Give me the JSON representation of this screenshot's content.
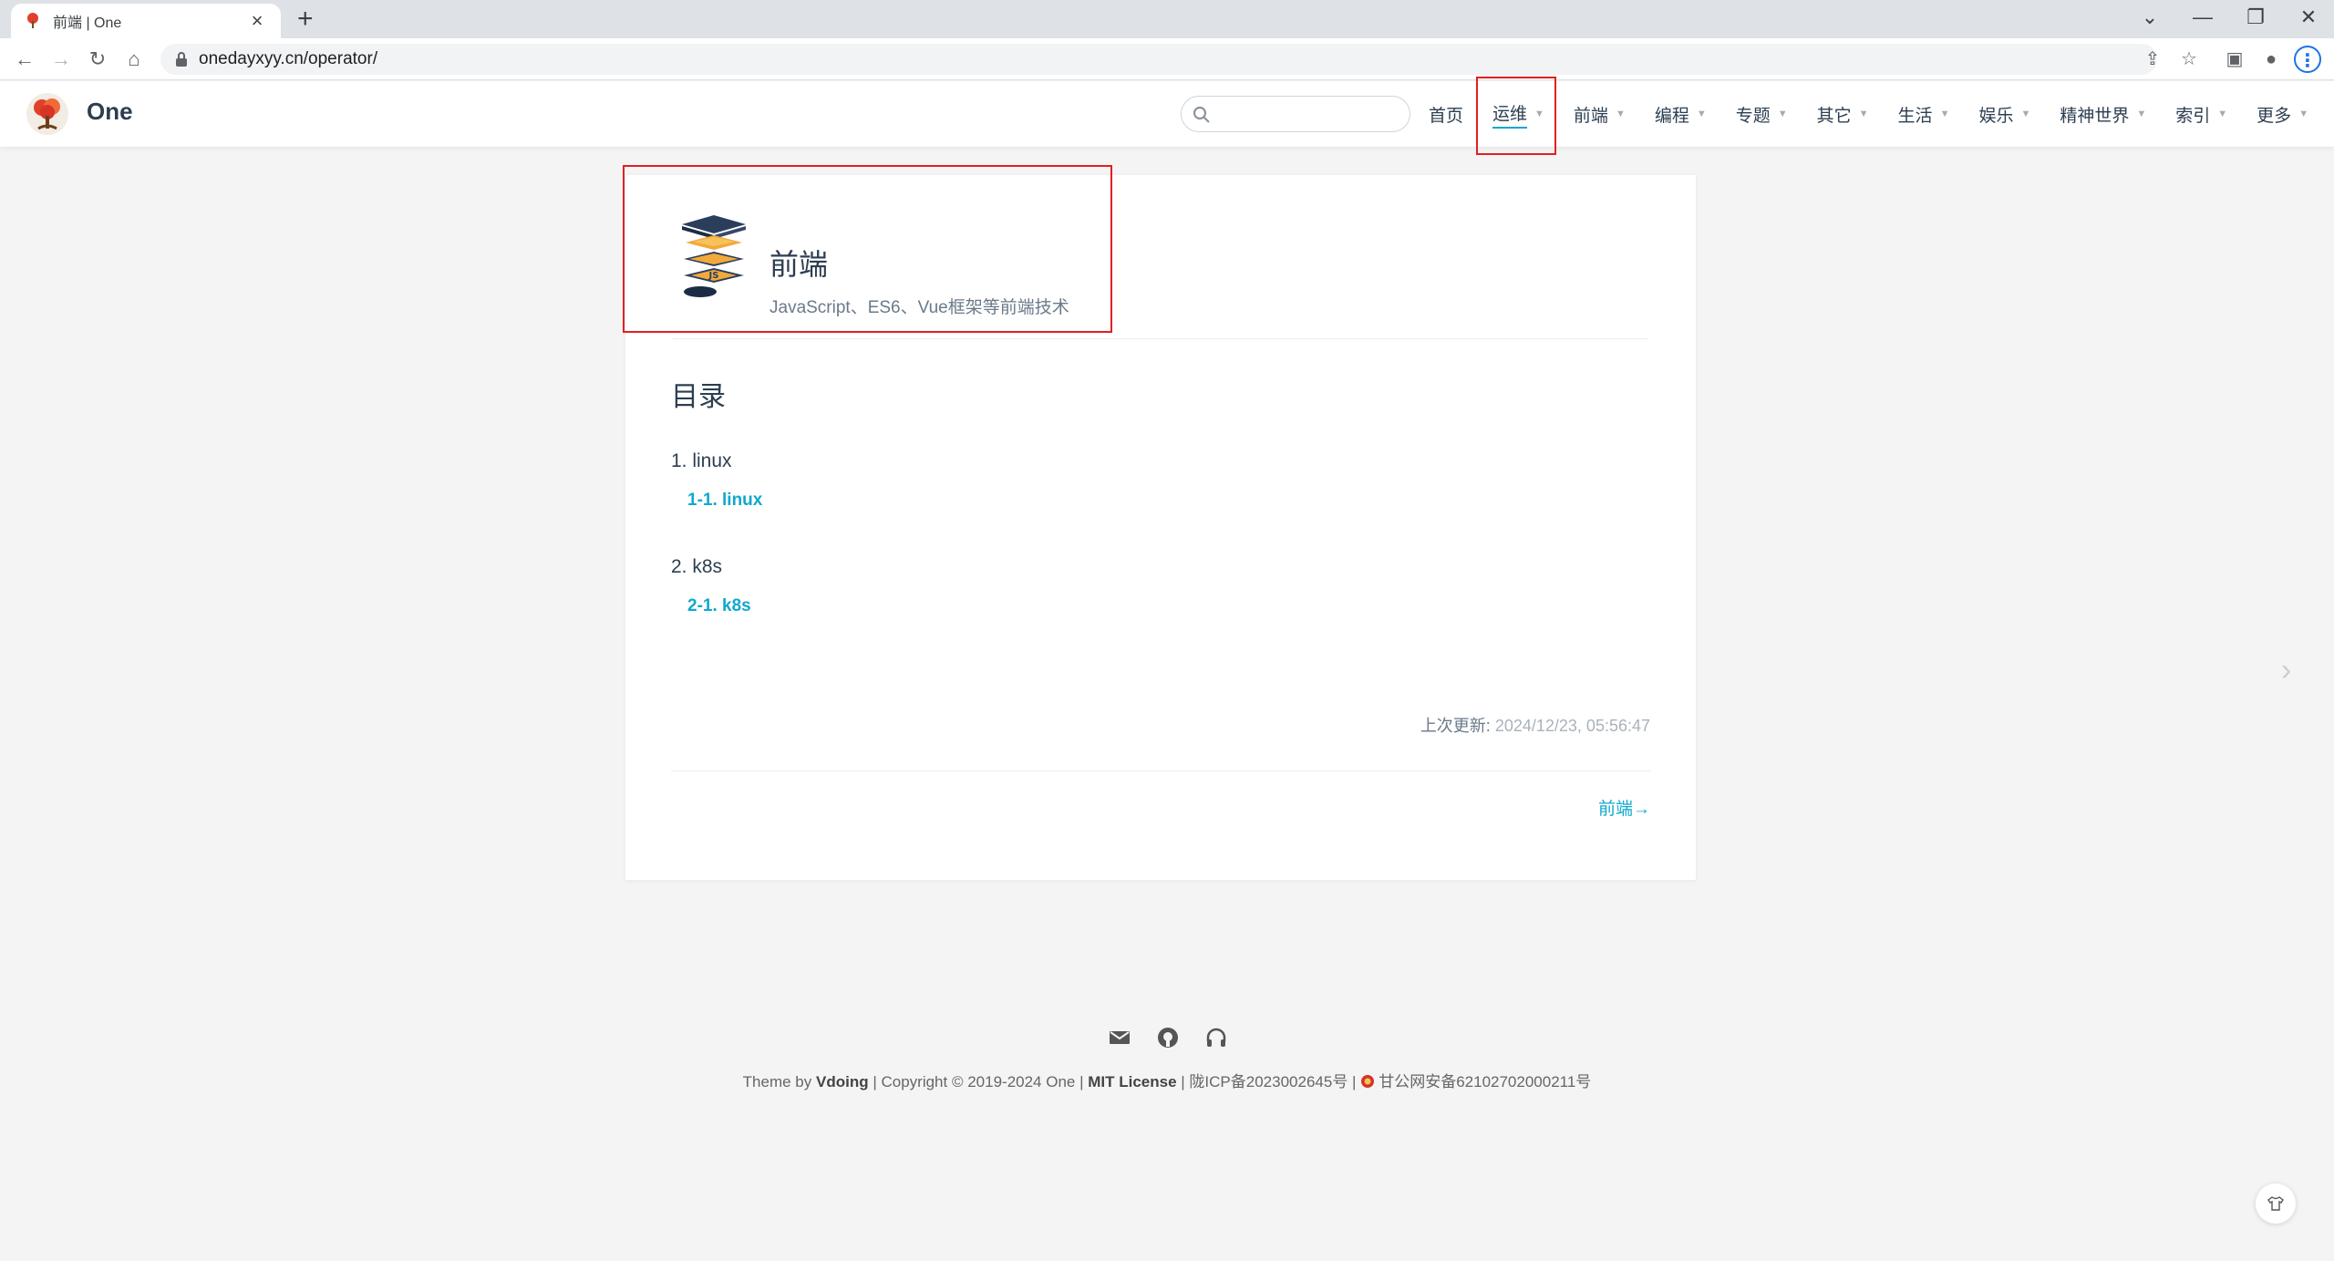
{
  "browser": {
    "tab_title": "前端 | One",
    "new_tab": "+",
    "close": "×",
    "url": "onedayxyy.cn/operator/",
    "minimize": "—",
    "restore": "❐",
    "window_close": "✕",
    "chevron": "⌄"
  },
  "site": {
    "name": "One",
    "search_placeholder": ""
  },
  "nav": {
    "items": [
      {
        "label": "首页",
        "caret": ""
      },
      {
        "label": "运维",
        "caret": "▼"
      },
      {
        "label": "前端",
        "caret": "▼"
      },
      {
        "label": "编程",
        "caret": "▼"
      },
      {
        "label": "专题",
        "caret": "▼"
      },
      {
        "label": "其它",
        "caret": "▼"
      },
      {
        "label": "生活",
        "caret": "▼"
      },
      {
        "label": "娱乐",
        "caret": "▼"
      },
      {
        "label": "精神世界",
        "caret": "▼"
      },
      {
        "label": "索引",
        "caret": "▼"
      },
      {
        "label": "更多",
        "caret": "▼"
      }
    ]
  },
  "category": {
    "title": "前端",
    "description": "JavaScript、ES6、Vue框架等前端技术"
  },
  "toc": {
    "title": "目录",
    "groups": [
      {
        "label": "1. linux",
        "link": "1-1. linux"
      },
      {
        "label": "2. k8s",
        "link": "2-1. k8s"
      }
    ]
  },
  "meta": {
    "last_updated_label": "上次更新:",
    "last_updated_time": "2024/12/23, 05:56:47"
  },
  "pager": {
    "next": "前端→"
  },
  "footer": {
    "theme_by": "Theme by",
    "theme_name": "Vdoing",
    "copyright": "| Copyright © 2019-2024 One |",
    "license": "MIT License",
    "icp": "| 陇ICP备2023002645号 |",
    "police": "甘公网安备62102702000211号"
  },
  "colors": {
    "accent": "#11a8cd",
    "highlight_box": "#e02020",
    "text": "#2c3e50"
  }
}
